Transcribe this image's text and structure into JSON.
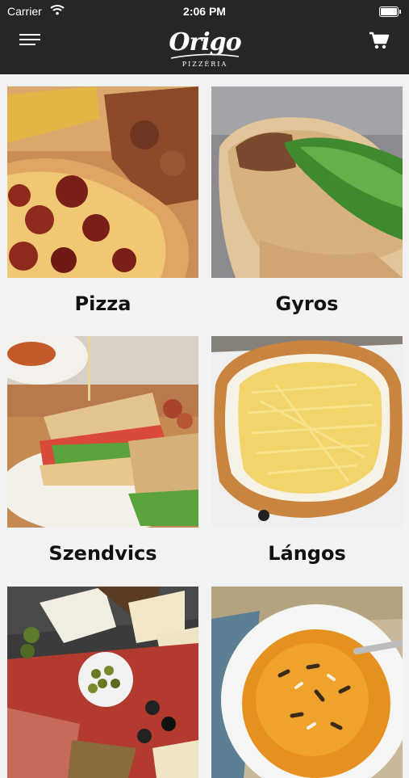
{
  "status_bar": {
    "carrier": "Carrier",
    "time": "2:06 PM"
  },
  "header": {
    "brand": "Origo",
    "brand_sub": "PIZZÉRIA"
  },
  "categories": [
    {
      "label": "Pizza"
    },
    {
      "label": "Gyros"
    },
    {
      "label": "Szendvics"
    },
    {
      "label": "Lángos"
    }
  ],
  "colors": {
    "header_bg": "#262626",
    "page_bg": "#f2f2f2",
    "text": "#111111"
  },
  "icons": [
    "wifi-icon",
    "battery-icon",
    "hamburger-menu-icon",
    "shopping-cart-icon"
  ]
}
